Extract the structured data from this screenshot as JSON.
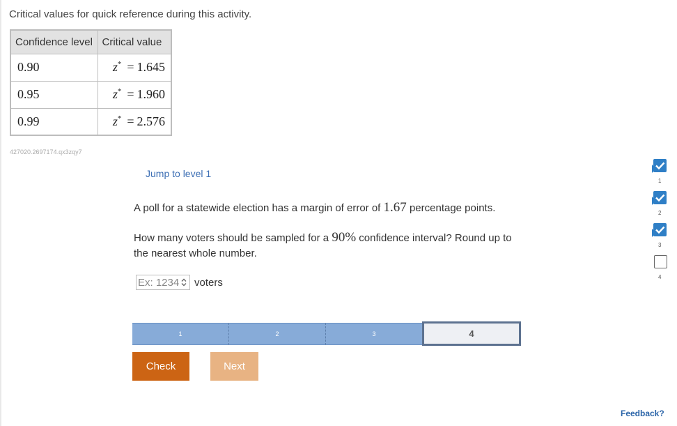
{
  "intro": "Critical values for quick reference during this activity.",
  "table": {
    "headers": [
      "Confidence level",
      "Critical value"
    ],
    "rows": [
      {
        "level": "0.90",
        "symbol": "z",
        "sup": "*",
        "eq": "=",
        "value": "1.645"
      },
      {
        "level": "0.95",
        "symbol": "z",
        "sup": "*",
        "eq": "=",
        "value": "1.960"
      },
      {
        "level": "0.99",
        "symbol": "z",
        "sup": "*",
        "eq": "=",
        "value": "2.576"
      }
    ]
  },
  "question_id": "427020.2697174.qx3zqy7",
  "jump_link": "Jump to level 1",
  "question": {
    "line1_pre": "A poll for a statewide election has a margin of error of ",
    "line1_math": "1.67",
    "line1_post": " percentage points.",
    "line2_pre": "How many voters should be sampled for a ",
    "line2_math": "90%",
    "line2_post": " confidence interval? Round up to the nearest whole number."
  },
  "answer": {
    "placeholder": "Ex: 1234",
    "unit": "voters"
  },
  "levels": [
    {
      "label": "1",
      "state": "done"
    },
    {
      "label": "2",
      "state": "done"
    },
    {
      "label": "3",
      "state": "done"
    },
    {
      "label": "4",
      "state": "current"
    }
  ],
  "buttons": {
    "check": "Check",
    "next": "Next"
  },
  "progress": [
    {
      "num": "1",
      "state": "checked"
    },
    {
      "num": "2",
      "state": "checked"
    },
    {
      "num": "3",
      "state": "checked"
    },
    {
      "num": "4",
      "state": "empty"
    }
  ],
  "feedback": "Feedback?",
  "colors": {
    "accent": "#2f7fc6",
    "check_button": "#cc6414",
    "next_button": "#e8b383",
    "level_bar": "#87abd8",
    "link": "#3d6fb4"
  }
}
